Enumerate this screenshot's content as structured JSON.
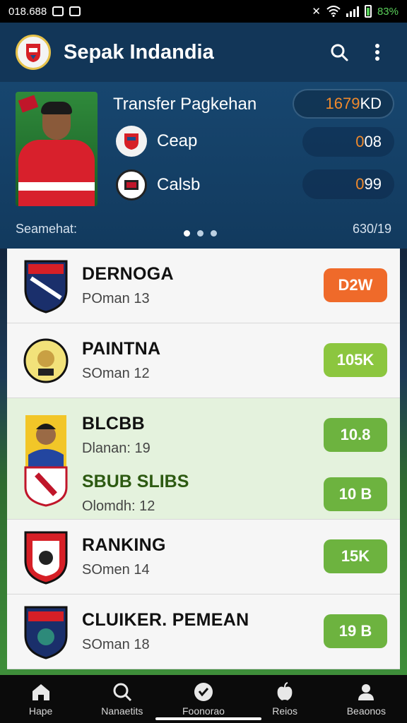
{
  "status": {
    "time": "018.688",
    "battery": "83%",
    "battery_color": "#5ad05a"
  },
  "app": {
    "title": "Sepak Indandia",
    "accent": "#123658"
  },
  "hero": {
    "title": "Transfer Pagkehan",
    "main_value_orange": "1679",
    "main_value_white": "KD",
    "clubs": [
      {
        "name": "Ceap",
        "value_orange": "0",
        "value_white": "08"
      },
      {
        "name": "Calsb",
        "value_orange": "0",
        "value_white": "99"
      }
    ],
    "left_footer": "Seamehat:",
    "right_footer": "630/19",
    "value_color": "#f08a2c"
  },
  "list": [
    {
      "title": "DERNOGA",
      "sub": "POman 13",
      "badge": "D2W",
      "badge_color": "#ef6a2a"
    },
    {
      "title": "PAINTNA",
      "sub": "SOman 12",
      "badge": "105K",
      "badge_color": "#8cc63f"
    },
    {
      "title": "BLCBB",
      "sub": "Dlanan: 19",
      "badge": "10.8",
      "badge_color": "#6db33f",
      "title2": "SBUB SLIBS",
      "sub2": "Olomdh: 12",
      "badge2": "10 B",
      "badge2_color": "#6db33f"
    },
    {
      "title": "RANKING",
      "sub": "SOmen 14",
      "badge": "15K",
      "badge_color": "#6db33f"
    },
    {
      "title": "CLUIKER. PEMEAN",
      "sub": "SOman 18",
      "badge": "19 B",
      "badge_color": "#6db33f"
    }
  ],
  "nav": [
    {
      "label": "Hape",
      "icon": "home-icon"
    },
    {
      "label": "Nanaetits",
      "icon": "search-icon"
    },
    {
      "label": "Foonorao",
      "icon": "ball-icon"
    },
    {
      "label": "Reios",
      "icon": "apple-icon"
    },
    {
      "label": "Beaonos",
      "icon": "person-icon"
    }
  ]
}
